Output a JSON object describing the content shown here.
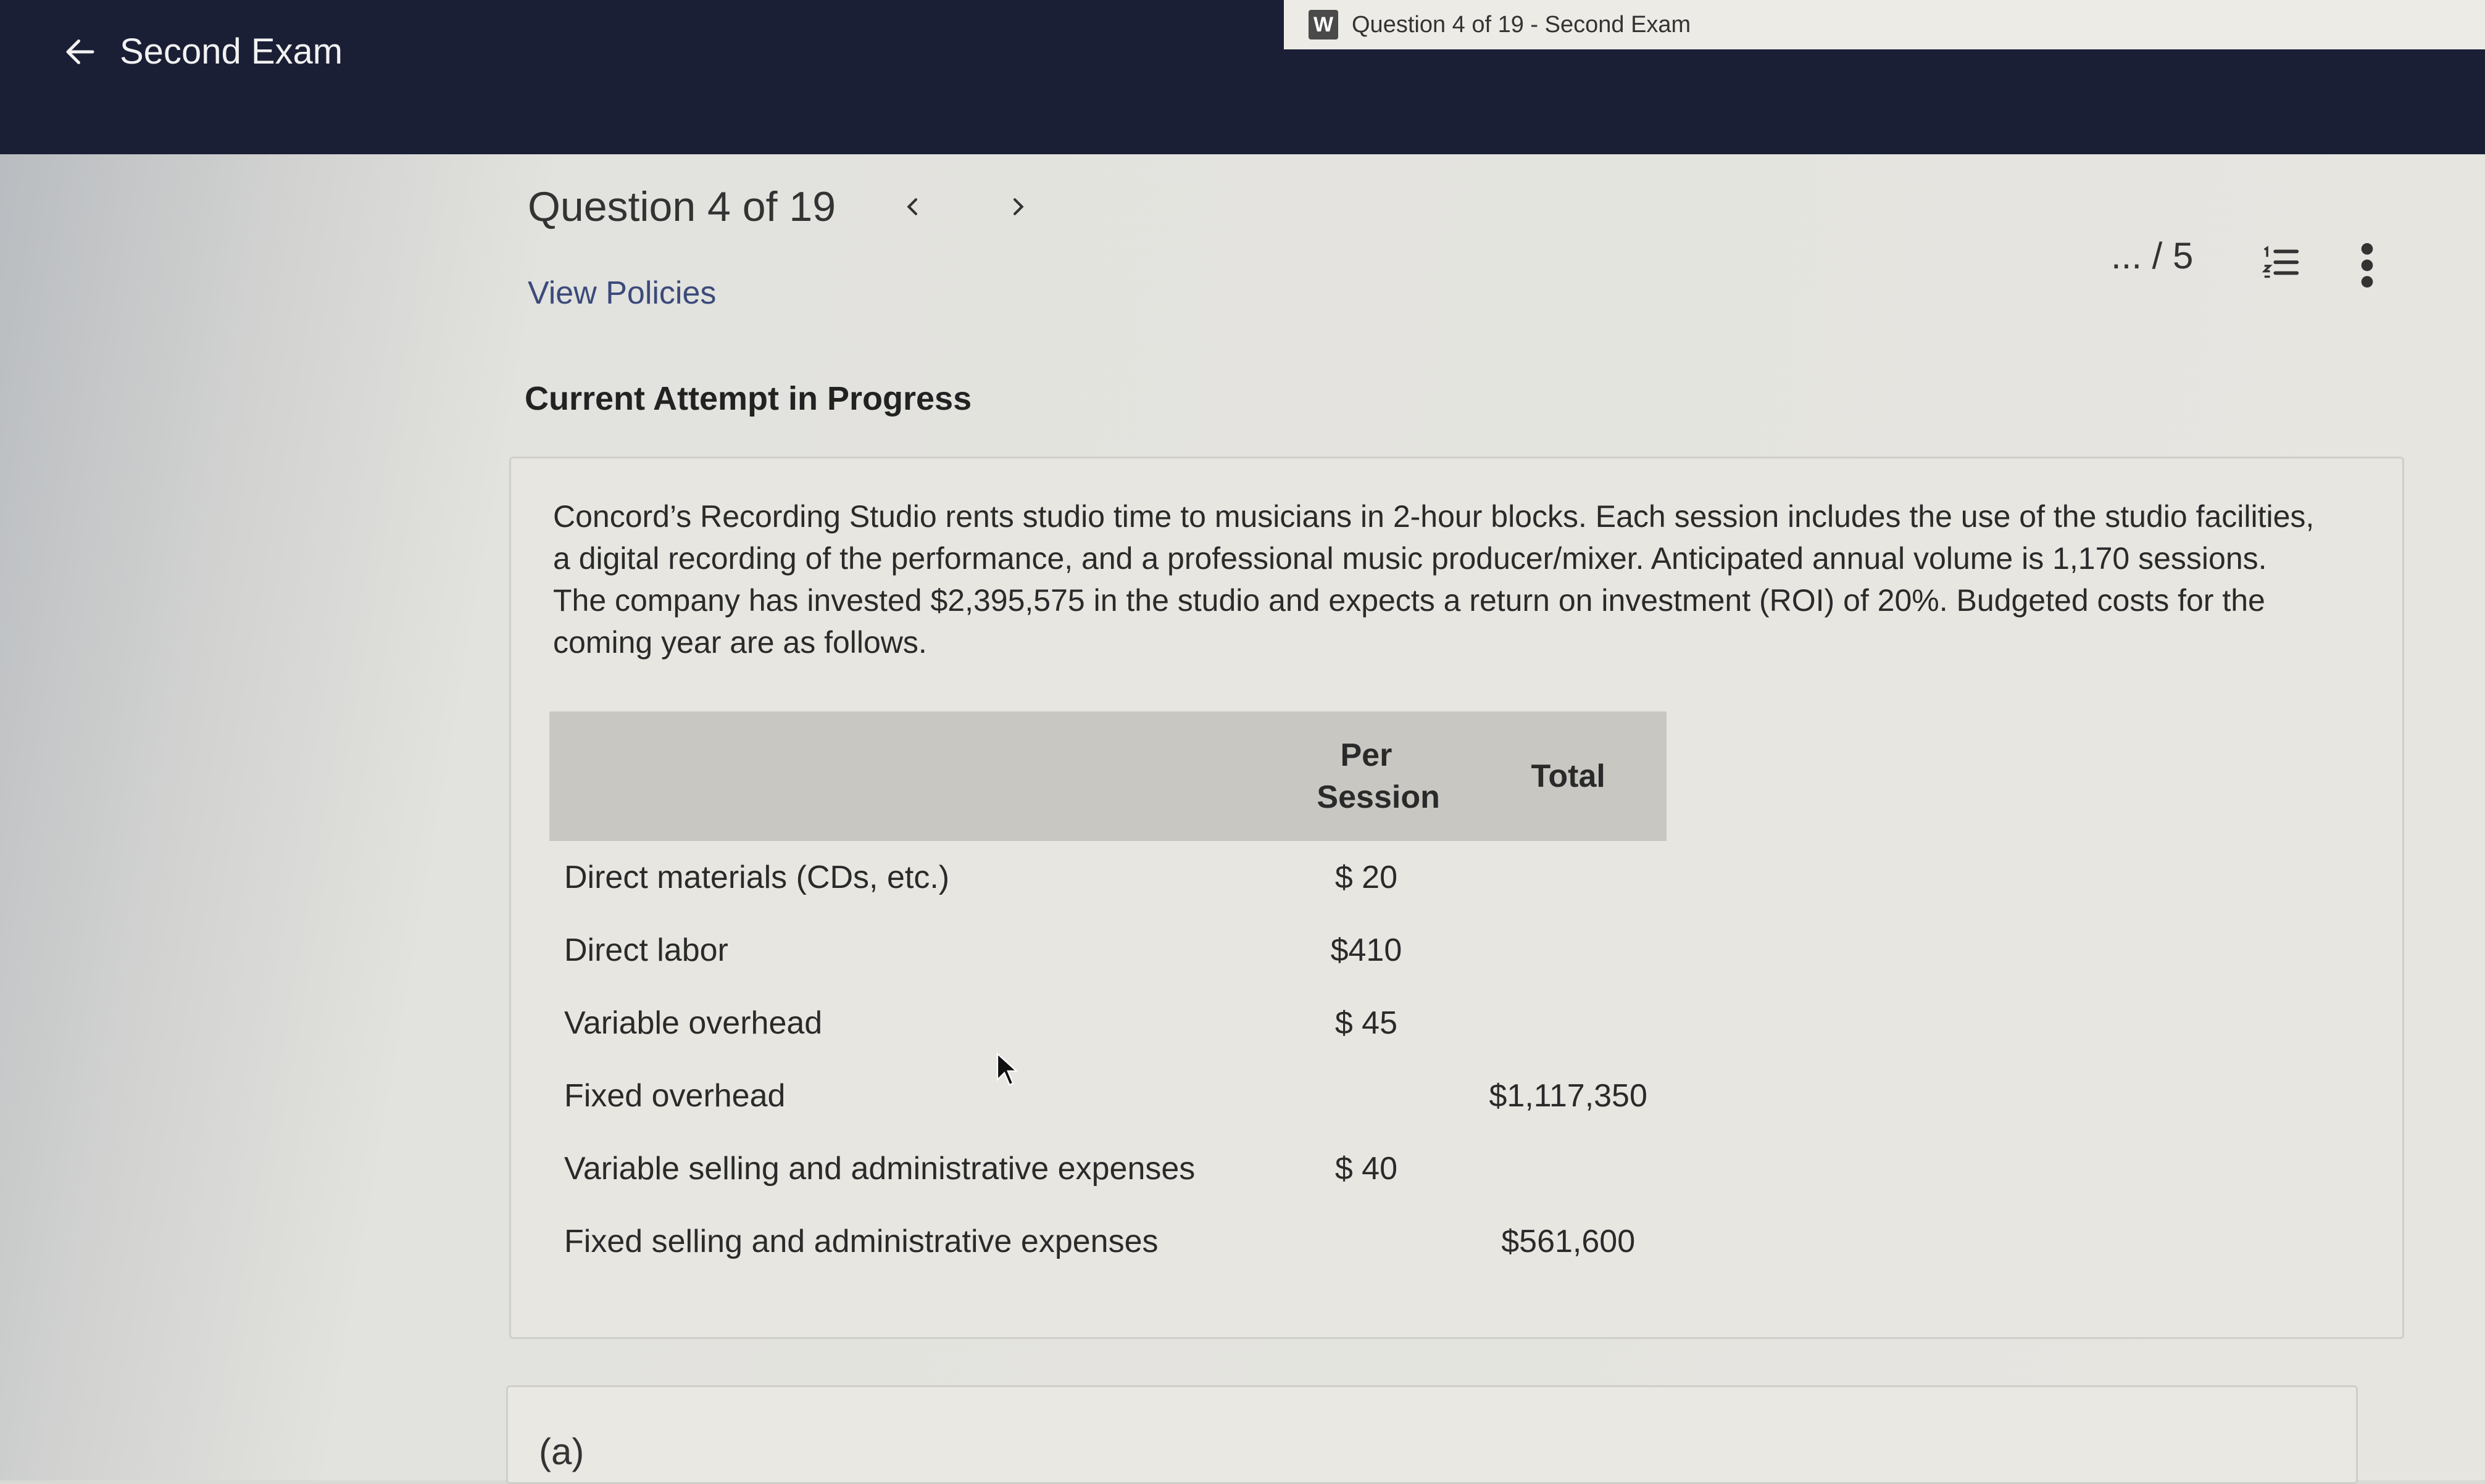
{
  "header": {
    "tab_title": "Question 4 of 19 - Second Exam",
    "tab_logo": "W",
    "back_label": "Second Exam",
    "back_icon": "arrow-left-icon"
  },
  "question": {
    "title": "Question 4 of 19",
    "prev_icon": "chevron-left-icon",
    "next_icon": "chevron-right-icon",
    "view_policies": "View Policies",
    "score": "... / 5",
    "list_icon": "numbered-list-icon",
    "more_icon": "more-vertical-icon"
  },
  "attempt_label": "Current Attempt in Progress",
  "problem_text": "Concord’s Recording Studio rents studio time to musicians in 2-hour blocks. Each session includes the use of the studio facilities, a digital recording of the performance, and a professional music producer/mixer. Anticipated annual volume is 1,170 sessions. The company has invested $2,395,575 in the studio and expects a return on investment (ROI) of 20%. Budgeted costs for the coming year are as follows.",
  "table": {
    "headers": [
      "",
      "Per Session",
      "Total"
    ],
    "rows": [
      {
        "label": "Direct materials (CDs, etc.)",
        "per_session": "$ 20",
        "total": ""
      },
      {
        "label": "Direct labor",
        "per_session": "$410",
        "total": ""
      },
      {
        "label": "Variable overhead",
        "per_session": "$ 45",
        "total": ""
      },
      {
        "label": "Fixed overhead",
        "per_session": "",
        "total": "$1,117,350"
      },
      {
        "label": "Variable selling and administrative expenses",
        "per_session": "$ 40",
        "total": ""
      },
      {
        "label": "Fixed selling and administrative expenses",
        "per_session": "",
        "total": "$561,600"
      }
    ]
  },
  "part_label": "(a)"
}
